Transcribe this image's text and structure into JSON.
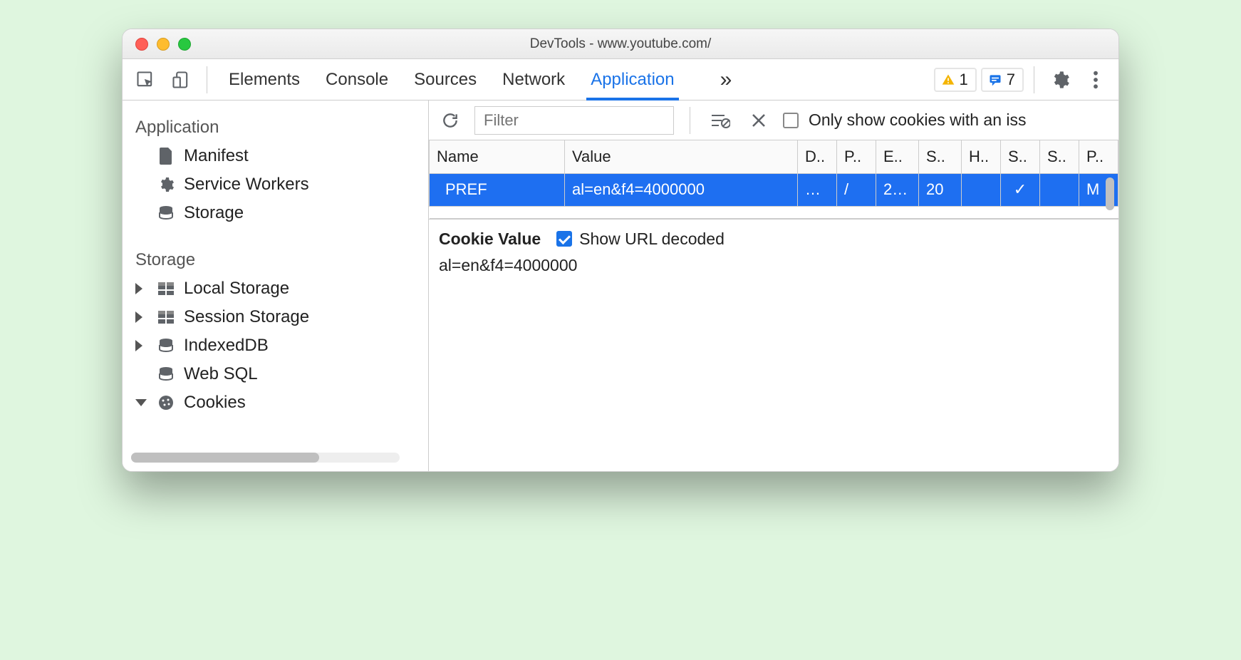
{
  "window": {
    "title": "DevTools - www.youtube.com/"
  },
  "toolbar": {
    "tabs": [
      "Elements",
      "Console",
      "Sources",
      "Network",
      "Application"
    ],
    "active_tab_index": 4,
    "more_label": "»",
    "warn_count": "1",
    "info_count": "7"
  },
  "sidebar": {
    "section1_title": "Application",
    "section1_items": [
      {
        "icon": "file",
        "label": "Manifest"
      },
      {
        "icon": "gear",
        "label": "Service Workers"
      },
      {
        "icon": "db",
        "label": "Storage"
      }
    ],
    "section2_title": "Storage",
    "section2_items": [
      {
        "caret": "right",
        "icon": "grid",
        "label": "Local Storage"
      },
      {
        "caret": "right",
        "icon": "grid",
        "label": "Session Storage"
      },
      {
        "caret": "right",
        "icon": "db",
        "label": "IndexedDB"
      },
      {
        "caret": "none",
        "icon": "db",
        "label": "Web SQL"
      },
      {
        "caret": "down",
        "icon": "cookie",
        "label": "Cookies"
      }
    ]
  },
  "filterbar": {
    "placeholder": "Filter",
    "only_issues_label": "Only show cookies with an iss"
  },
  "table": {
    "cols": [
      "Name",
      "Value",
      "D..",
      "P..",
      "E..",
      "S..",
      "H..",
      "S..",
      "S..",
      "P.."
    ],
    "row": {
      "name": "PREF",
      "value": "al=en&f4=4000000",
      "domain": "…",
      "path": "/",
      "expires": "2…",
      "size": "20",
      "http": "",
      "secure": "✓",
      "same": "",
      "priority": "M"
    }
  },
  "detail": {
    "heading": "Cookie Value",
    "decoded_label": "Show URL decoded",
    "value": "al=en&f4=4000000"
  }
}
